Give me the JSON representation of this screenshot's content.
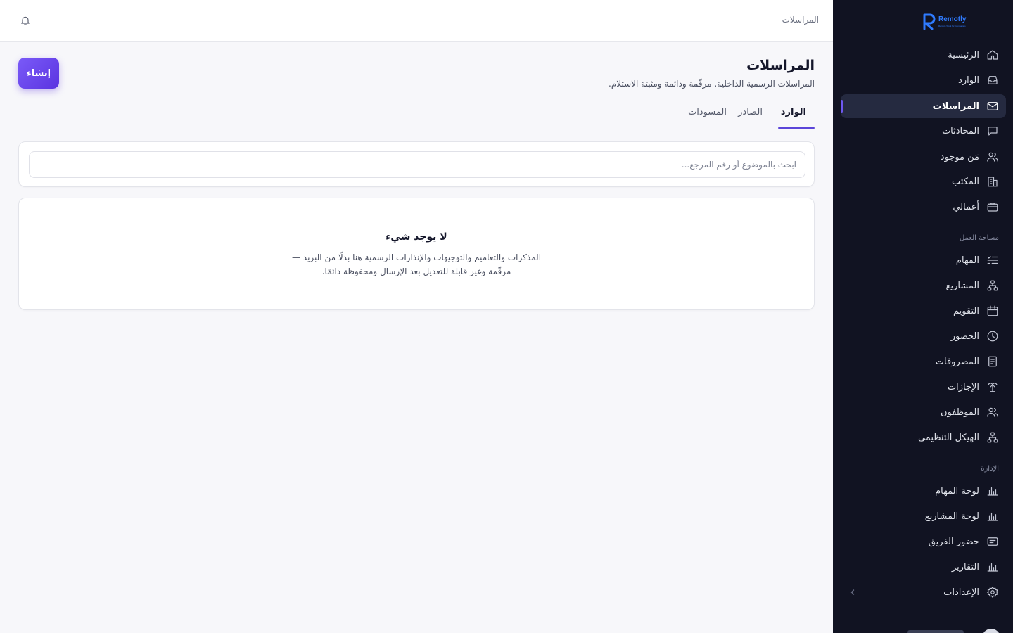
{
  "brand": {
    "name": "Remotly",
    "tagline": "Remote Work for Companies",
    "color": "#2f7bff"
  },
  "topbar": {
    "breadcrumb": "المراسلات",
    "bell_icon": "bell-icon"
  },
  "sidebar": {
    "items": [
      {
        "label": "الرئيسية",
        "icon": "home-icon"
      },
      {
        "label": "الوارد",
        "icon": "inbox-icon"
      },
      {
        "label": "المراسلات",
        "icon": "mail-icon",
        "active": true
      },
      {
        "label": "المحادثات",
        "icon": "chat-icon"
      },
      {
        "label": "مَن موجود",
        "icon": "users-icon"
      },
      {
        "label": "المكتب",
        "icon": "building-icon"
      },
      {
        "label": "أعمالي",
        "icon": "briefcase-icon"
      }
    ],
    "workspace_label": "مساحة العمل",
    "workspace_items": [
      {
        "label": "المهام",
        "icon": "tasks-icon"
      },
      {
        "label": "المشاريع",
        "icon": "projects-icon"
      },
      {
        "label": "التقويم",
        "icon": "calendar-icon"
      },
      {
        "label": "الحضور",
        "icon": "clock-icon"
      },
      {
        "label": "المصروفات",
        "icon": "receipt-icon"
      },
      {
        "label": "الإجازات",
        "icon": "vacation-icon"
      },
      {
        "label": "الموظفون",
        "icon": "employees-icon"
      },
      {
        "label": "الهيكل التنظيمي",
        "icon": "org-chart-icon"
      }
    ],
    "admin_label": "الإدارة",
    "admin_items": [
      {
        "label": "لوحة المهام",
        "icon": "bar-chart-icon"
      },
      {
        "label": "لوحة المشاريع",
        "icon": "bar-chart-icon"
      },
      {
        "label": "حضور الفريق",
        "icon": "team-attendance-icon"
      },
      {
        "label": "التقارير",
        "icon": "bar-chart-icon"
      },
      {
        "label": "الإعدادات",
        "icon": "settings-icon"
      }
    ]
  },
  "page": {
    "title": "المراسلات",
    "subtitle": "المراسلات الرسمية الداخلية. مرقّمة ودائمة ومثبتة الاستلام.",
    "create_label": "إنشاء",
    "tabs": [
      {
        "label": "الوارد",
        "active": true
      },
      {
        "label": "الصادر"
      },
      {
        "label": "المسودات"
      }
    ],
    "search_placeholder": "ابحث بالموضوع أو رقم المرجع...",
    "empty_title": "لا يوجد شيء",
    "empty_line1": "المذكرات والتعاميم والتوجيهات والإنذارات الرسمية هنا بدلًا من البريد —",
    "empty_line2": "مرقّمة وغير قابلة للتعديل بعد الإرسال ومحفوظة دائمًا."
  },
  "colors": {
    "sidebar_bg": "#111322",
    "accent": "#5b45d9",
    "button_gradient_start": "#7a5af8",
    "button_gradient_end": "#5b34e0"
  }
}
